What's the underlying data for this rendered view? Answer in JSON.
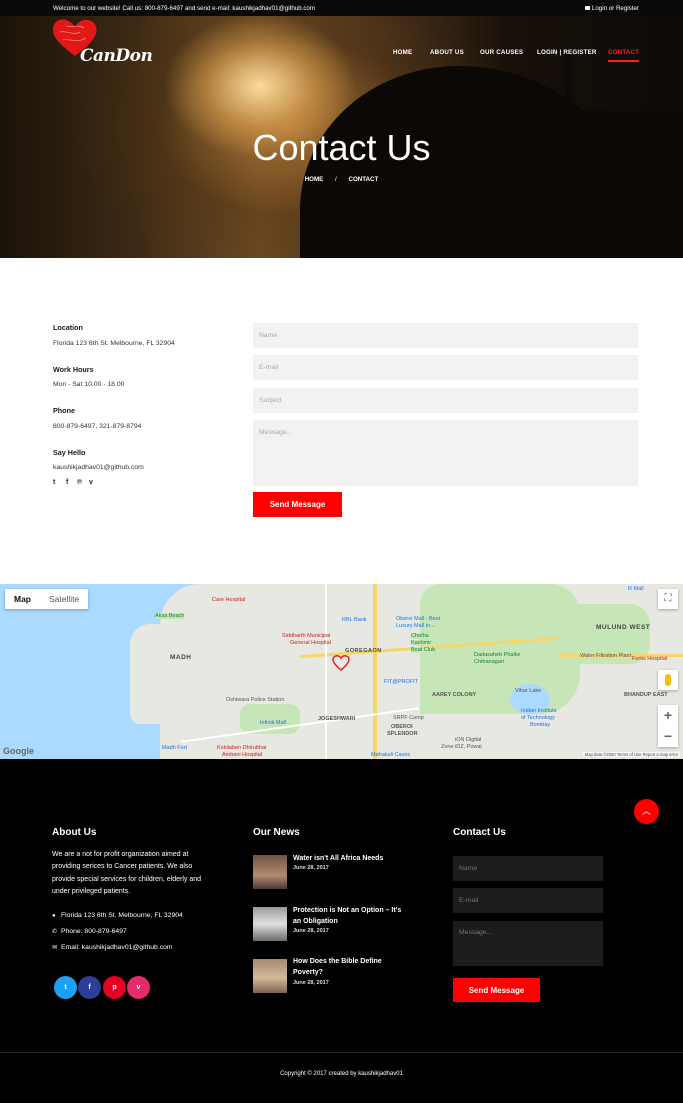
{
  "topbar": {
    "welcome": "Welcome to our website! Call us: 800-879-6497 and send e-mail: kaushikjadhav01@github.com",
    "login": "Login or Register"
  },
  "brand": {
    "name": "CanDon",
    "accent": "#ff1e1e"
  },
  "nav": {
    "items": [
      "HOME",
      "ABOUT US",
      "OUR CAUSES",
      "LOGIN | REGISTER",
      "CONTACT"
    ],
    "active": "CONTACT"
  },
  "hero": {
    "title": "Contact Us",
    "breadcrumb_home": "HOME",
    "breadcrumb_sep": "/",
    "breadcrumb_current": "CONTACT"
  },
  "contact_info": {
    "location_label": "Location",
    "location_value": "Florida 123 6th St. Melbourne, FL 32904",
    "hours_label": "Work Hours",
    "hours_value": "Mon - Sat 10.00 - 18.00",
    "phone_label": "Phone",
    "phone_value": "800-879-6497, 321-879-8794",
    "hello_label": "Say Hello",
    "hello_value": "kaushikjadhav01@github.com",
    "social_icons": [
      "tumblr-icon",
      "facebook-icon",
      "pinterest-icon",
      "vimeo-icon"
    ],
    "social_glyphs": [
      "t",
      "f",
      "℗",
      "v"
    ]
  },
  "contact_form": {
    "name_placeholder": "Name",
    "email_placeholder": "E-mail",
    "subject_placeholder": "Subject",
    "message_placeholder": "Message...",
    "send_label": "Send Message"
  },
  "map": {
    "type_map": "Map",
    "type_satellite": "Satellite",
    "labels": {
      "aksa": "Aksa Beach",
      "care": "Care Hospital",
      "rbl": "RBL Bank",
      "oberoi_mall": "Oberoi Mall - Best",
      "luxury": "Luxury Mall in...",
      "r_mall": "R Mall",
      "mulund": "MULUND WEST",
      "madh": "MADH",
      "siddharth": "Siddharth Municipal",
      "general": "General Hospital",
      "goregaon": "GOREGAON",
      "chotha": "Chotha",
      "kashmir": "Kashmir",
      "boat": "Boat Club",
      "dadasaheb": "Dadasaheb Phalke",
      "chitranagari": "Chitranagari",
      "water": "Water Filtration Plant",
      "fortis": "Fortis Hospital",
      "fitprofit": "FIT@PROFIT",
      "aarey": "AAREY COLONY",
      "vihar": "Vihar Lake",
      "oshiwara": "Oshiwara Police Station",
      "iit": "Indian Institute",
      "iit2": "of Technology",
      "bombay": "Bombay",
      "bhandup": "BHANDUP EAST",
      "infiniti": "Infiniti Mall",
      "jogeshwari": "JOGESHWARI",
      "srpf": "SRPF Camp",
      "oberoi_splendor": "OBEROI",
      "splendor": "SPLENDOR",
      "ion": "iON Digital",
      "zone": "Zone iDZ, Powai",
      "madh_fort": "Madh Fort",
      "kokilaben": "Kokilaben Dhirubhai",
      "ambani": "Ambani Hospital",
      "mahakali": "Mahakali Caves"
    },
    "google": "Google",
    "attribution": "Map data ©2020   Terms of Use   Report a map error"
  },
  "footer": {
    "about_title": "About Us",
    "about_text": "We are a not for profit organization aimed at providing serices to Cancer patients. We also provide special services for children, elderly and under privileged patients.",
    "address": "Florida 123 6th St. Melbourne, FL 32904",
    "phone": "Phone: 800-879-6497",
    "email": "Email: kaushikjadhav01@github.com",
    "social": [
      {
        "glyph": "t",
        "color": "#1da1f2"
      },
      {
        "glyph": "f",
        "color": "#2c3e96"
      },
      {
        "glyph": "p",
        "color": "#e60023"
      },
      {
        "glyph": "v",
        "color": "#e62b6b"
      }
    ],
    "news_title": "Our News",
    "news": [
      {
        "title": "Water isn't All Africa Needs",
        "date": "June 28, 2017"
      },
      {
        "title": "Protection is Not an Option – It's an Obligation",
        "date": "June 28, 2017"
      },
      {
        "title": "How Does the Bible Define Poverty?",
        "date": "June 28, 2017"
      }
    ],
    "contact_title": "Contact Us",
    "name_placeholder": "Name",
    "email_placeholder": "E-mail",
    "message_placeholder": "Message...",
    "send_label": "Send Message",
    "copyright": "Copyright © 2017 created by kaushikjadhav01"
  }
}
